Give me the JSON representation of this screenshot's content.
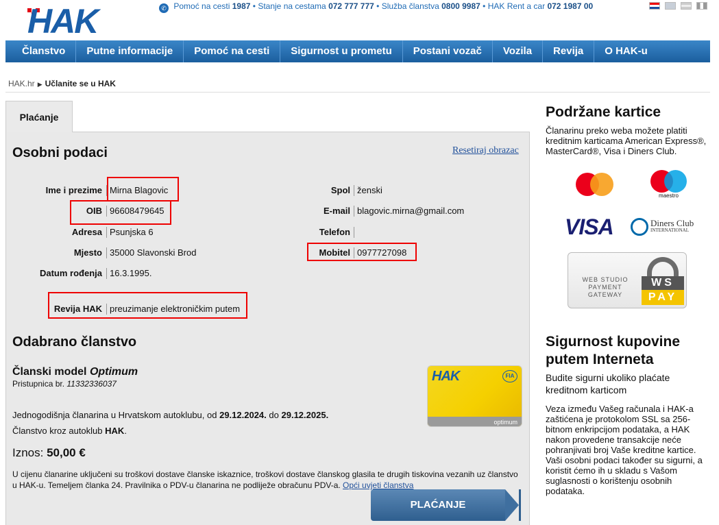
{
  "header": {
    "logo_text": "HAK",
    "info": {
      "pomoc_label": "Pomoć na cesti",
      "pomoc_number": "1987",
      "stanje_label": "Stanje na cestama",
      "stanje_number": "072 777 777",
      "sluzba_label": "Služba članstva",
      "sluzba_number": "0800 9987",
      "rent_label": "HAK Rent a car",
      "rent_number": "072 1987 00",
      "separator": "•"
    },
    "flags": [
      "croatian-flag",
      "english-flag",
      "german-flag",
      "italian-flag"
    ]
  },
  "nav": {
    "items": [
      "Članstvo",
      "Putne informacije",
      "Pomoć na cesti",
      "Sigurnost u prometu",
      "Postani vozač",
      "Vozila",
      "Revija",
      "O HAK-u"
    ]
  },
  "breadcrumb": {
    "home": "HAK.hr",
    "current": "Učlanite se u HAK"
  },
  "tab": {
    "label": "Plaćanje"
  },
  "personal": {
    "title": "Osobni podaci",
    "reset": "Resetiraj obrazac",
    "fields": {
      "name": {
        "label": "Ime i prezime",
        "value": "Mirna Blagovic"
      },
      "oib": {
        "label": "OIB",
        "value": "96608479645"
      },
      "address": {
        "label": "Adresa",
        "value": "Psunjska 6"
      },
      "city": {
        "label": "Mjesto",
        "value": "35000 Slavonski Brod"
      },
      "dob": {
        "label": "Datum rođenja",
        "value": "16.3.1995."
      },
      "revija": {
        "label": "Revija HAK",
        "value": "preuzimanje elektroničkim putem"
      },
      "gender": {
        "label": "Spol",
        "value": "ženski"
      },
      "email": {
        "label": "E-mail",
        "value": "blagovic.mirna@gmail.com"
      },
      "phone": {
        "label": "Telefon",
        "value": ""
      },
      "mobile": {
        "label": "Mobitel",
        "value": "0977727098"
      }
    }
  },
  "membership": {
    "title": "Odabrano članstvo",
    "model_prefix": "Članski model",
    "model_name": "Optimum",
    "pristupnica_label": "Pristupnica br.",
    "pristupnica_number": "11332336037",
    "yearly_text": "Jednogodišnja članarina u Hrvatskom autoklubu, od",
    "date_from": "29.12.2024.",
    "do": "do",
    "date_to": "29.12.2025.",
    "via_text": "Članstvo kroz autoklub",
    "via_club": "HAK",
    "amount_label": "Iznos:",
    "amount_value": "50,00 €",
    "note": "U cijenu članarine uključeni su troškovi dostave članske iskaznice, troškovi dostave članskog glasila te drugih tiskovina vezanih uz članstvo u HAK-u. Temeljem članka 24. Pravilnika o PDV-u članarina ne podliježe obračunu PDV-a.",
    "note_link": "Opći uvjeti članstva",
    "card": {
      "logo": "HAK",
      "badge": "FIA",
      "tier": "optimum"
    }
  },
  "pay_button": "PLAĆANJE",
  "sidebar": {
    "cards_title": "Podržane kartice",
    "cards_text": "Članarinu preko weba možete platiti kreditnim karticama American Express®, MasterCard®, Visa i Diners Club.",
    "maestro_label": "maestro",
    "visa_label": "VISA",
    "diners_label": "Diners Club",
    "diners_sub": "INTERNATIONAL",
    "wspay_left": "WEB STUDIO PAYMENT GATEWAY",
    "wspay_ws": "WS",
    "wspay_pay": "PAY",
    "security_title": "Sigurnost kupovine putem Interneta",
    "security_lead": "Budite sigurni ukoliko plaćate kreditnom karticom",
    "security_text": "Veza između Vašeg računala i HAK-a zaštićena je protokolom SSL sa 256-bitnom enkripcijom podataka, a HAK nakon provedene transakcije neće pohranjivati broj Vaše kreditne kartice. Vaši osobni podaci također su sigurni, a koristit ćemo ih u skladu s Vašom suglasnosti o korištenju osobnih podataka."
  },
  "colors": {
    "brand_blue": "#1a5ea8",
    "nav_blue": "#2a72b8",
    "highlight_red": "#ee0000",
    "card_yellow": "#f5d000"
  }
}
